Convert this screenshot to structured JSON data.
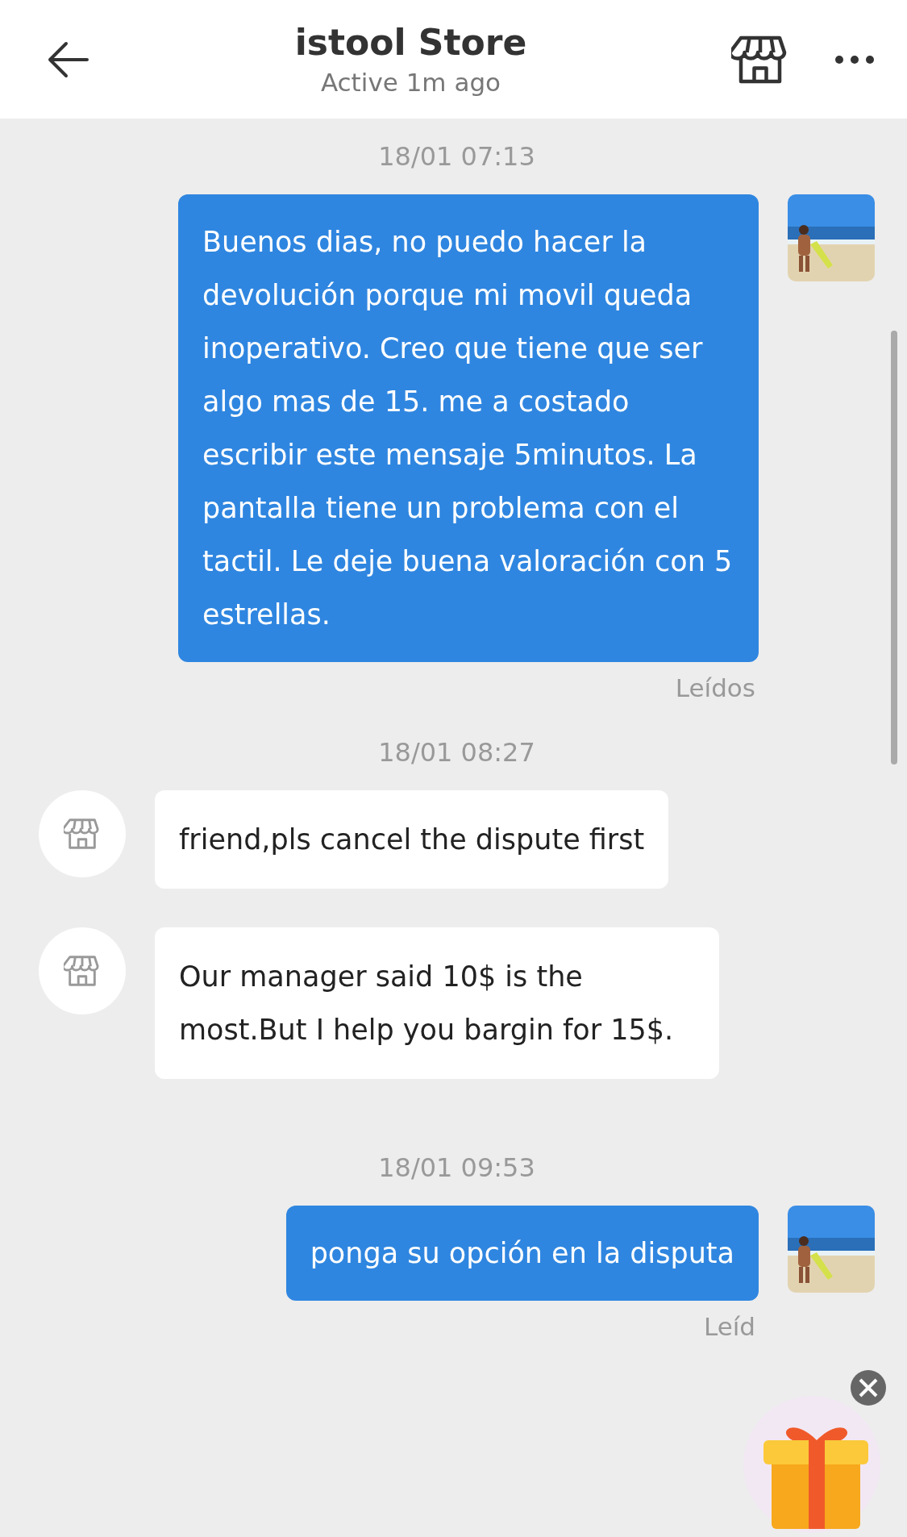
{
  "header": {
    "title": "istool Store",
    "subtitle": "Active 1m ago"
  },
  "conversation": [
    {
      "kind": "timestamp",
      "text": "18/01 07:13"
    },
    {
      "kind": "sent",
      "text": "Buenos dias, no puedo hacer la devolución porque mi movil queda inoperativo. Creo que tiene que ser algo mas de 15. me a costado escribir este mensaje 5minutos. La pantalla tiene un problema con el tactil. Le deje buena valoración con 5 estrellas.",
      "status": "Leídos"
    },
    {
      "kind": "timestamp",
      "text": "18/01 08:27"
    },
    {
      "kind": "received",
      "text": "friend,pls cancel the dispute first"
    },
    {
      "kind": "received",
      "text": "Our manager said 10$ is the most.But I help you bargin for 15$."
    },
    {
      "kind": "timestamp",
      "text": "18/01 09:53"
    },
    {
      "kind": "sent",
      "text": "ponga su opción en la disputa",
      "status": "Leíd"
    }
  ]
}
